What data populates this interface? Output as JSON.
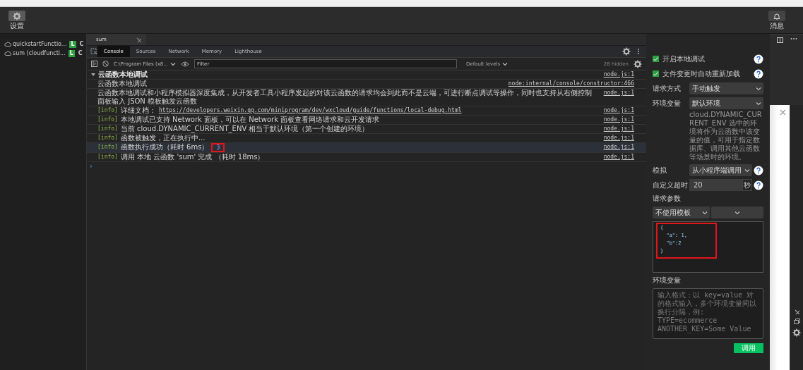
{
  "toolbar": {
    "settings_label": "设置",
    "messages_label": "消息"
  },
  "functions": [
    {
      "name": "quickstartFunctio...",
      "badge": "L",
      "action": "C"
    },
    {
      "name": "sum (cloudfuncti...",
      "badge": "L",
      "action": "C"
    }
  ],
  "editor_tabs": [
    {
      "label": "sum",
      "selected": true
    }
  ],
  "devtools": {
    "tabs": [
      {
        "label": "Console",
        "selected": true
      },
      {
        "label": "Sources",
        "selected": false
      },
      {
        "label": "Network",
        "selected": false
      },
      {
        "label": "Memory",
        "selected": false
      },
      {
        "label": "Lighthouse",
        "selected": false
      }
    ],
    "context": "C:\\Program Files (x8...",
    "filter_placeholder": "Filter",
    "levels": "Default levels",
    "hidden_count": "28 hidden"
  },
  "console": {
    "group": {
      "title": "云函数本地调试",
      "expanded": true,
      "source": "node.js:1"
    },
    "lines": [
      {
        "kind": "plain",
        "text": "云函数本地调试",
        "source": "node:internal/console/constructor:466"
      },
      {
        "kind": "plain",
        "text": "云函数本地调试和小程序模拟器深度集成，从开发者工具小程序发起的对该云函数的请求均会到此而不是云端，可进行断点调试等操作，同时也支持从右侧控制面板输入 JSON 模板触发云函数",
        "source": "node.js:1"
      },
      {
        "kind": "info",
        "tag": "[info]",
        "text": "详细文档：",
        "link": "https://developers.weixin.qq.com/miniprogram/dev/wxcloud/guide/functions/local-debug.html",
        "source": "node.js:1"
      },
      {
        "kind": "info",
        "tag": "[info]",
        "text": "本地调试已支持 Network 面板，可以在 Network 面板查看网络请求和云开发请求",
        "source": "node.js:1"
      },
      {
        "kind": "info",
        "tag": "[info]",
        "text": "当前 cloud.DYNAMIC_CURRENT_ENV 相当于默认环境（第一个创建的环境）",
        "source": "node.js:1"
      },
      {
        "kind": "info",
        "tag": "[info]",
        "text": "函数被触发，正在执行中...",
        "source": "node.js:1"
      },
      {
        "kind": "info",
        "tag": "[info]",
        "text": "函数执行成功（耗时 6ms）",
        "result": "3",
        "highlighted": true,
        "selected": true,
        "source": "node.js:1"
      },
      {
        "kind": "info",
        "tag": "[info]",
        "text": "调用 本地 云函数 'sum' 完成 （耗时 18ms）",
        "source": "node.js:1"
      }
    ],
    "prompt": "›"
  },
  "debug": {
    "checks": [
      {
        "label": "开启本地调试",
        "checked": true
      },
      {
        "label": "文件变更时自动重新加载",
        "checked": true
      }
    ],
    "fields": [
      {
        "kind": "select",
        "label": "请求方式",
        "value": "手动触发"
      },
      {
        "kind": "select",
        "label": "环境变量",
        "value": "默认环境",
        "note": "cloud.DYNAMIC_CURRENT_ENV 选中的环境将作为云函数中该变量的值，可用于指定数据库、调用其他云函数等场景时的环境。"
      },
      {
        "kind": "select",
        "label": "模拟",
        "value": "从小程序端调用",
        "help": true
      },
      {
        "kind": "number",
        "label": "自定义超时",
        "value": "20",
        "unit": "秒",
        "help": true
      }
    ],
    "params_label": "请求参数",
    "template": "不使用模板",
    "editor": {
      "lines": [
        "{",
        "  \"a\": 1,",
        "  \"b\":2",
        "}"
      ],
      "highlighted": true
    },
    "env_label": "环境变量",
    "env_placeholder": "输入格式：以 key=value 对的格式输入，多个环境变量间以换行分隔，例:\nTYPE=ecommerce\nANOTHER_KEY=Some Value",
    "invoke_button": "调用"
  }
}
